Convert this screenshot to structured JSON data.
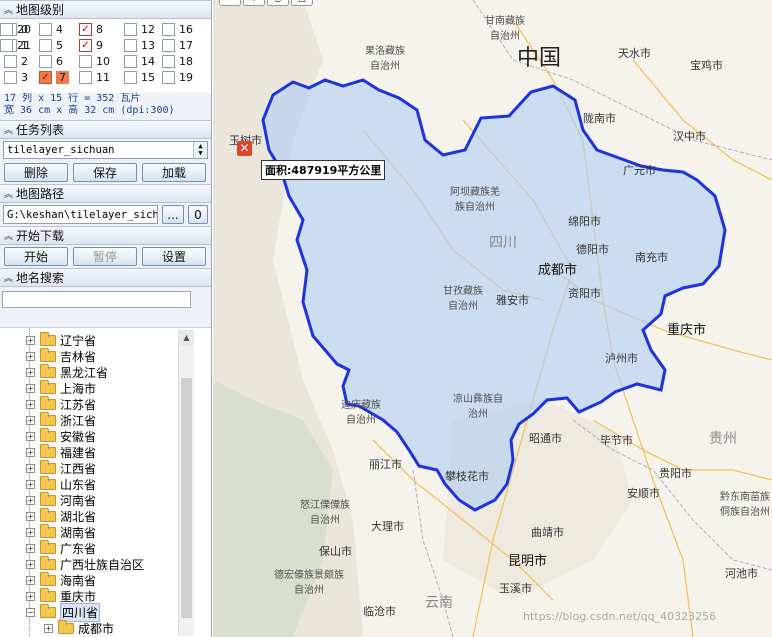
{
  "panel": {
    "level_header": "地图级别",
    "levels": [
      {
        "n": "0",
        "checked": false
      },
      {
        "n": "1",
        "checked": false
      },
      {
        "n": "2",
        "checked": false
      },
      {
        "n": "3",
        "checked": false
      },
      {
        "n": "4",
        "checked": false
      },
      {
        "n": "5",
        "checked": false
      },
      {
        "n": "6",
        "checked": false
      },
      {
        "n": "7",
        "checked": true,
        "highlight": true
      },
      {
        "n": "8",
        "checked": true
      },
      {
        "n": "9",
        "checked": true
      },
      {
        "n": "10",
        "checked": false
      },
      {
        "n": "11",
        "checked": false
      },
      {
        "n": "12",
        "checked": false
      },
      {
        "n": "13",
        "checked": false
      },
      {
        "n": "14",
        "checked": false
      },
      {
        "n": "15",
        "checked": false
      },
      {
        "n": "16",
        "checked": false
      },
      {
        "n": "17",
        "checked": false
      },
      {
        "n": "18",
        "checked": false
      },
      {
        "n": "19",
        "checked": false
      },
      {
        "n": "20",
        "checked": false
      },
      {
        "n": "21",
        "checked": false
      }
    ],
    "tile_info": "17 列 x 15 行 = 352 瓦片",
    "size_info": "宽 36 cm x 高 32 cm (dpi:300)",
    "task_header": "任务列表",
    "task_value": "tilelayer_sichuan",
    "delete_label": "删除",
    "save_label": "保存",
    "load_label": "加载",
    "path_header": "地图路径",
    "path_value": "G:\\keshan\\tilelayer_sichu",
    "browse_label": "...",
    "zero_label": "0",
    "download_header": "开始下载",
    "start_label": "开始",
    "pause_label": "暂停",
    "settings_label": "设置",
    "search_header": "地名搜索",
    "search_value": ""
  },
  "tree": {
    "items": [
      {
        "label": "辽宁省",
        "expanded": false
      },
      {
        "label": "吉林省",
        "expanded": false
      },
      {
        "label": "黑龙江省",
        "expanded": false
      },
      {
        "label": "上海市",
        "expanded": false
      },
      {
        "label": "江苏省",
        "expanded": false
      },
      {
        "label": "浙江省",
        "expanded": false
      },
      {
        "label": "安徽省",
        "expanded": false
      },
      {
        "label": "福建省",
        "expanded": false
      },
      {
        "label": "江西省",
        "expanded": false
      },
      {
        "label": "山东省",
        "expanded": false
      },
      {
        "label": "河南省",
        "expanded": false
      },
      {
        "label": "湖北省",
        "expanded": false
      },
      {
        "label": "湖南省",
        "expanded": false
      },
      {
        "label": "广东省",
        "expanded": false
      },
      {
        "label": "广西壮族自治区",
        "expanded": false
      },
      {
        "label": "海南省",
        "expanded": false
      },
      {
        "label": "重庆市",
        "expanded": false
      },
      {
        "label": "四川省",
        "expanded": true,
        "selected": true
      },
      {
        "label": "成都市",
        "expanded": false,
        "child": true
      }
    ]
  },
  "map": {
    "area_tooltip": "面积:487919平方公里",
    "country_label": "中国",
    "watermark": "https://blog.csdn.net/qq_40323256",
    "labels": {
      "gansu": "甘南藏族自治州",
      "guoluo": "果洛藏族自治州",
      "aba": "阿坝藏族羌族自治州",
      "ganzi": "甘孜藏族自治州",
      "liangshan": "凉山彝族自治州",
      "diqing": "迪庆藏族自治州",
      "nujiang": "怒江傈僳族自治州",
      "dehong": "德宏傣族景颇族自治州",
      "qiandongnan": "黔东南苗族侗族自治州",
      "sichuan": "四川",
      "guizhou": "贵州",
      "yunnan": "云南"
    },
    "cities": {
      "tianshui": "天水市",
      "baoji": "宝鸡市",
      "longnan": "陇南市",
      "hanzhong": "汉中市",
      "guangyuan": "广元市",
      "mianyang": "绵阳市",
      "deyang": "德阳市",
      "nanchong": "南充市",
      "chengdu": "成都市",
      "ziyang": "资阳市",
      "yaan": "雅安市",
      "chongqing": "重庆市",
      "luzhou": "泸州市",
      "zhaotong": "昭通市",
      "bijie": "毕节市",
      "guiyang": "贵阳市",
      "anshun": "安顺市",
      "panzhihua": "攀枝花市",
      "lijiang": "丽江市",
      "dali": "大理市",
      "qujing": "曲靖市",
      "kunming": "昆明市",
      "yuxi": "玉溪市",
      "baoshan": "保山市",
      "lincang": "临沧市",
      "hechi": "河池市",
      "yushu": "玉树市"
    }
  }
}
